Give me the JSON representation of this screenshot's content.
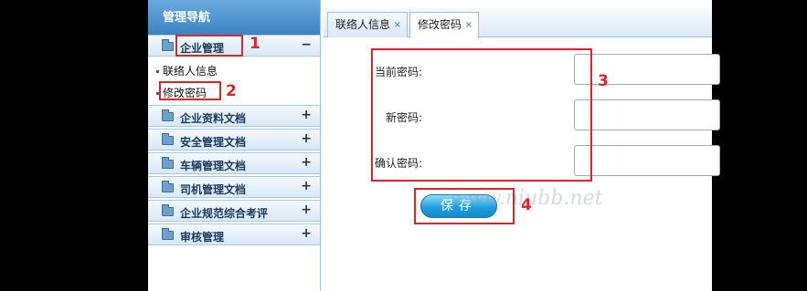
{
  "sidebar": {
    "title": "管理导航",
    "groups": [
      {
        "label": "企业管理",
        "toggle": "−"
      },
      {
        "label": "企业资料文档",
        "toggle": "+"
      },
      {
        "label": "安全管理文档",
        "toggle": "+"
      },
      {
        "label": "车辆管理文档",
        "toggle": "+"
      },
      {
        "label": "司机管理文档",
        "toggle": "+"
      },
      {
        "label": "企业规范综合考评",
        "toggle": "+"
      },
      {
        "label": "审核管理",
        "toggle": "+"
      }
    ],
    "sub_items": [
      {
        "label": "联络人信息"
      },
      {
        "label": "修改密码"
      }
    ]
  },
  "tabs": [
    {
      "label": "联络人信息",
      "close": "×"
    },
    {
      "label": "修改密码",
      "close": "×",
      "active": true
    }
  ],
  "form": {
    "current_label": "当前密码:",
    "new_label": "新密码:",
    "confirm_label": "确认密码:",
    "current_value": "",
    "new_value": "",
    "confirm_value": "",
    "save_label": "保存"
  },
  "annotations": [
    "1",
    "2",
    "3",
    "4"
  ],
  "watermark": "www.niubb.net",
  "colors": {
    "annotation": "#d9262c",
    "nav_header": "#3d82c2",
    "button": "#1f9fe0"
  }
}
